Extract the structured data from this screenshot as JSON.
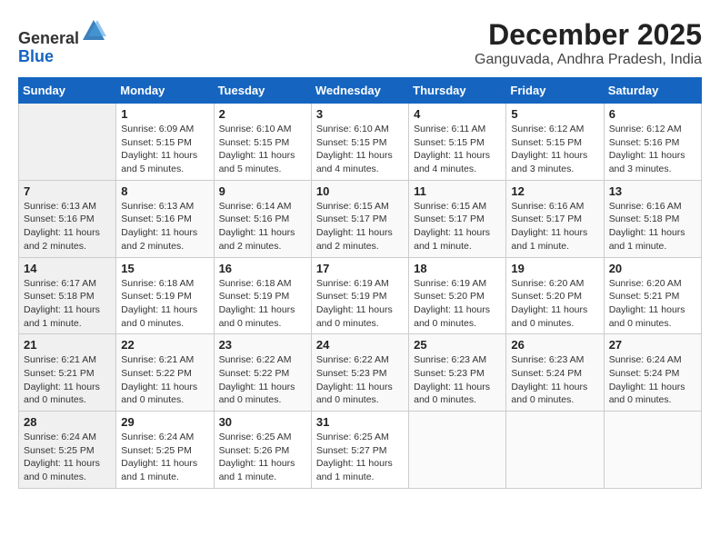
{
  "header": {
    "logo_line1": "General",
    "logo_line2": "Blue",
    "month_year": "December 2025",
    "location": "Ganguvada, Andhra Pradesh, India"
  },
  "weekdays": [
    "Sunday",
    "Monday",
    "Tuesday",
    "Wednesday",
    "Thursday",
    "Friday",
    "Saturday"
  ],
  "weeks": [
    [
      {
        "day": "",
        "info": ""
      },
      {
        "day": "1",
        "info": "Sunrise: 6:09 AM\nSunset: 5:15 PM\nDaylight: 11 hours\nand 5 minutes."
      },
      {
        "day": "2",
        "info": "Sunrise: 6:10 AM\nSunset: 5:15 PM\nDaylight: 11 hours\nand 5 minutes."
      },
      {
        "day": "3",
        "info": "Sunrise: 6:10 AM\nSunset: 5:15 PM\nDaylight: 11 hours\nand 4 minutes."
      },
      {
        "day": "4",
        "info": "Sunrise: 6:11 AM\nSunset: 5:15 PM\nDaylight: 11 hours\nand 4 minutes."
      },
      {
        "day": "5",
        "info": "Sunrise: 6:12 AM\nSunset: 5:15 PM\nDaylight: 11 hours\nand 3 minutes."
      },
      {
        "day": "6",
        "info": "Sunrise: 6:12 AM\nSunset: 5:16 PM\nDaylight: 11 hours\nand 3 minutes."
      }
    ],
    [
      {
        "day": "7",
        "info": "Sunrise: 6:13 AM\nSunset: 5:16 PM\nDaylight: 11 hours\nand 2 minutes."
      },
      {
        "day": "8",
        "info": "Sunrise: 6:13 AM\nSunset: 5:16 PM\nDaylight: 11 hours\nand 2 minutes."
      },
      {
        "day": "9",
        "info": "Sunrise: 6:14 AM\nSunset: 5:16 PM\nDaylight: 11 hours\nand 2 minutes."
      },
      {
        "day": "10",
        "info": "Sunrise: 6:15 AM\nSunset: 5:17 PM\nDaylight: 11 hours\nand 2 minutes."
      },
      {
        "day": "11",
        "info": "Sunrise: 6:15 AM\nSunset: 5:17 PM\nDaylight: 11 hours\nand 1 minute."
      },
      {
        "day": "12",
        "info": "Sunrise: 6:16 AM\nSunset: 5:17 PM\nDaylight: 11 hours\nand 1 minute."
      },
      {
        "day": "13",
        "info": "Sunrise: 6:16 AM\nSunset: 5:18 PM\nDaylight: 11 hours\nand 1 minute."
      }
    ],
    [
      {
        "day": "14",
        "info": "Sunrise: 6:17 AM\nSunset: 5:18 PM\nDaylight: 11 hours\nand 1 minute."
      },
      {
        "day": "15",
        "info": "Sunrise: 6:18 AM\nSunset: 5:19 PM\nDaylight: 11 hours\nand 0 minutes."
      },
      {
        "day": "16",
        "info": "Sunrise: 6:18 AM\nSunset: 5:19 PM\nDaylight: 11 hours\nand 0 minutes."
      },
      {
        "day": "17",
        "info": "Sunrise: 6:19 AM\nSunset: 5:19 PM\nDaylight: 11 hours\nand 0 minutes."
      },
      {
        "day": "18",
        "info": "Sunrise: 6:19 AM\nSunset: 5:20 PM\nDaylight: 11 hours\nand 0 minutes."
      },
      {
        "day": "19",
        "info": "Sunrise: 6:20 AM\nSunset: 5:20 PM\nDaylight: 11 hours\nand 0 minutes."
      },
      {
        "day": "20",
        "info": "Sunrise: 6:20 AM\nSunset: 5:21 PM\nDaylight: 11 hours\nand 0 minutes."
      }
    ],
    [
      {
        "day": "21",
        "info": "Sunrise: 6:21 AM\nSunset: 5:21 PM\nDaylight: 11 hours\nand 0 minutes."
      },
      {
        "day": "22",
        "info": "Sunrise: 6:21 AM\nSunset: 5:22 PM\nDaylight: 11 hours\nand 0 minutes."
      },
      {
        "day": "23",
        "info": "Sunrise: 6:22 AM\nSunset: 5:22 PM\nDaylight: 11 hours\nand 0 minutes."
      },
      {
        "day": "24",
        "info": "Sunrise: 6:22 AM\nSunset: 5:23 PM\nDaylight: 11 hours\nand 0 minutes."
      },
      {
        "day": "25",
        "info": "Sunrise: 6:23 AM\nSunset: 5:23 PM\nDaylight: 11 hours\nand 0 minutes."
      },
      {
        "day": "26",
        "info": "Sunrise: 6:23 AM\nSunset: 5:24 PM\nDaylight: 11 hours\nand 0 minutes."
      },
      {
        "day": "27",
        "info": "Sunrise: 6:24 AM\nSunset: 5:24 PM\nDaylight: 11 hours\nand 0 minutes."
      }
    ],
    [
      {
        "day": "28",
        "info": "Sunrise: 6:24 AM\nSunset: 5:25 PM\nDaylight: 11 hours\nand 0 minutes."
      },
      {
        "day": "29",
        "info": "Sunrise: 6:24 AM\nSunset: 5:25 PM\nDaylight: 11 hours\nand 1 minute."
      },
      {
        "day": "30",
        "info": "Sunrise: 6:25 AM\nSunset: 5:26 PM\nDaylight: 11 hours\nand 1 minute."
      },
      {
        "day": "31",
        "info": "Sunrise: 6:25 AM\nSunset: 5:27 PM\nDaylight: 11 hours\nand 1 minute."
      },
      {
        "day": "",
        "info": ""
      },
      {
        "day": "",
        "info": ""
      },
      {
        "day": "",
        "info": ""
      }
    ]
  ]
}
